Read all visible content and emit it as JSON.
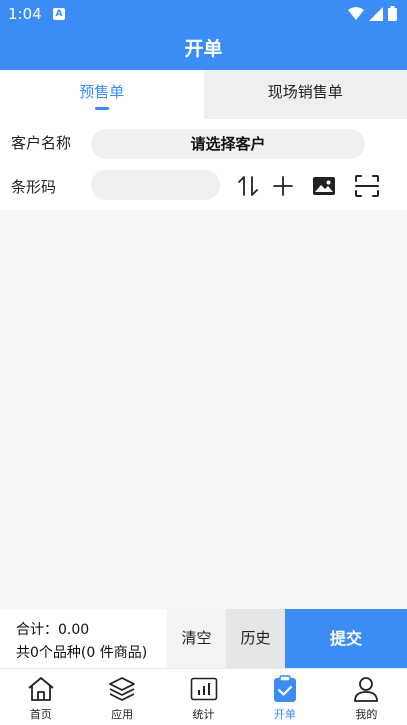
{
  "status_bar": {
    "time": "1:04",
    "notification_letter": "A"
  },
  "title": "开单",
  "tabs": [
    {
      "label": "预售单",
      "active": true
    },
    {
      "label": "现场销售单",
      "active": false
    }
  ],
  "form": {
    "customer_label": "客户名称",
    "customer_placeholder": "请选择客户",
    "barcode_label": "条形码",
    "barcode_value": "",
    "tools": [
      "sort-icon",
      "plus-icon",
      "image-icon",
      "scan-icon"
    ]
  },
  "summary": {
    "total_line": "合计：0.00",
    "count_line": "共0个品种(0 件商品)"
  },
  "actions": {
    "clear": "清空",
    "history": "历史",
    "submit": "提交"
  },
  "nav": [
    {
      "label": "首页",
      "icon": "home-icon",
      "active": false
    },
    {
      "label": "应用",
      "icon": "layers-icon",
      "active": false
    },
    {
      "label": "统计",
      "icon": "chart-icon",
      "active": false
    },
    {
      "label": "开单",
      "icon": "clipboard-check-icon",
      "active": true
    },
    {
      "label": "我的",
      "icon": "user-icon",
      "active": false
    }
  ],
  "colors": {
    "primary": "#3b8df5",
    "background": "#f7f7f7"
  }
}
